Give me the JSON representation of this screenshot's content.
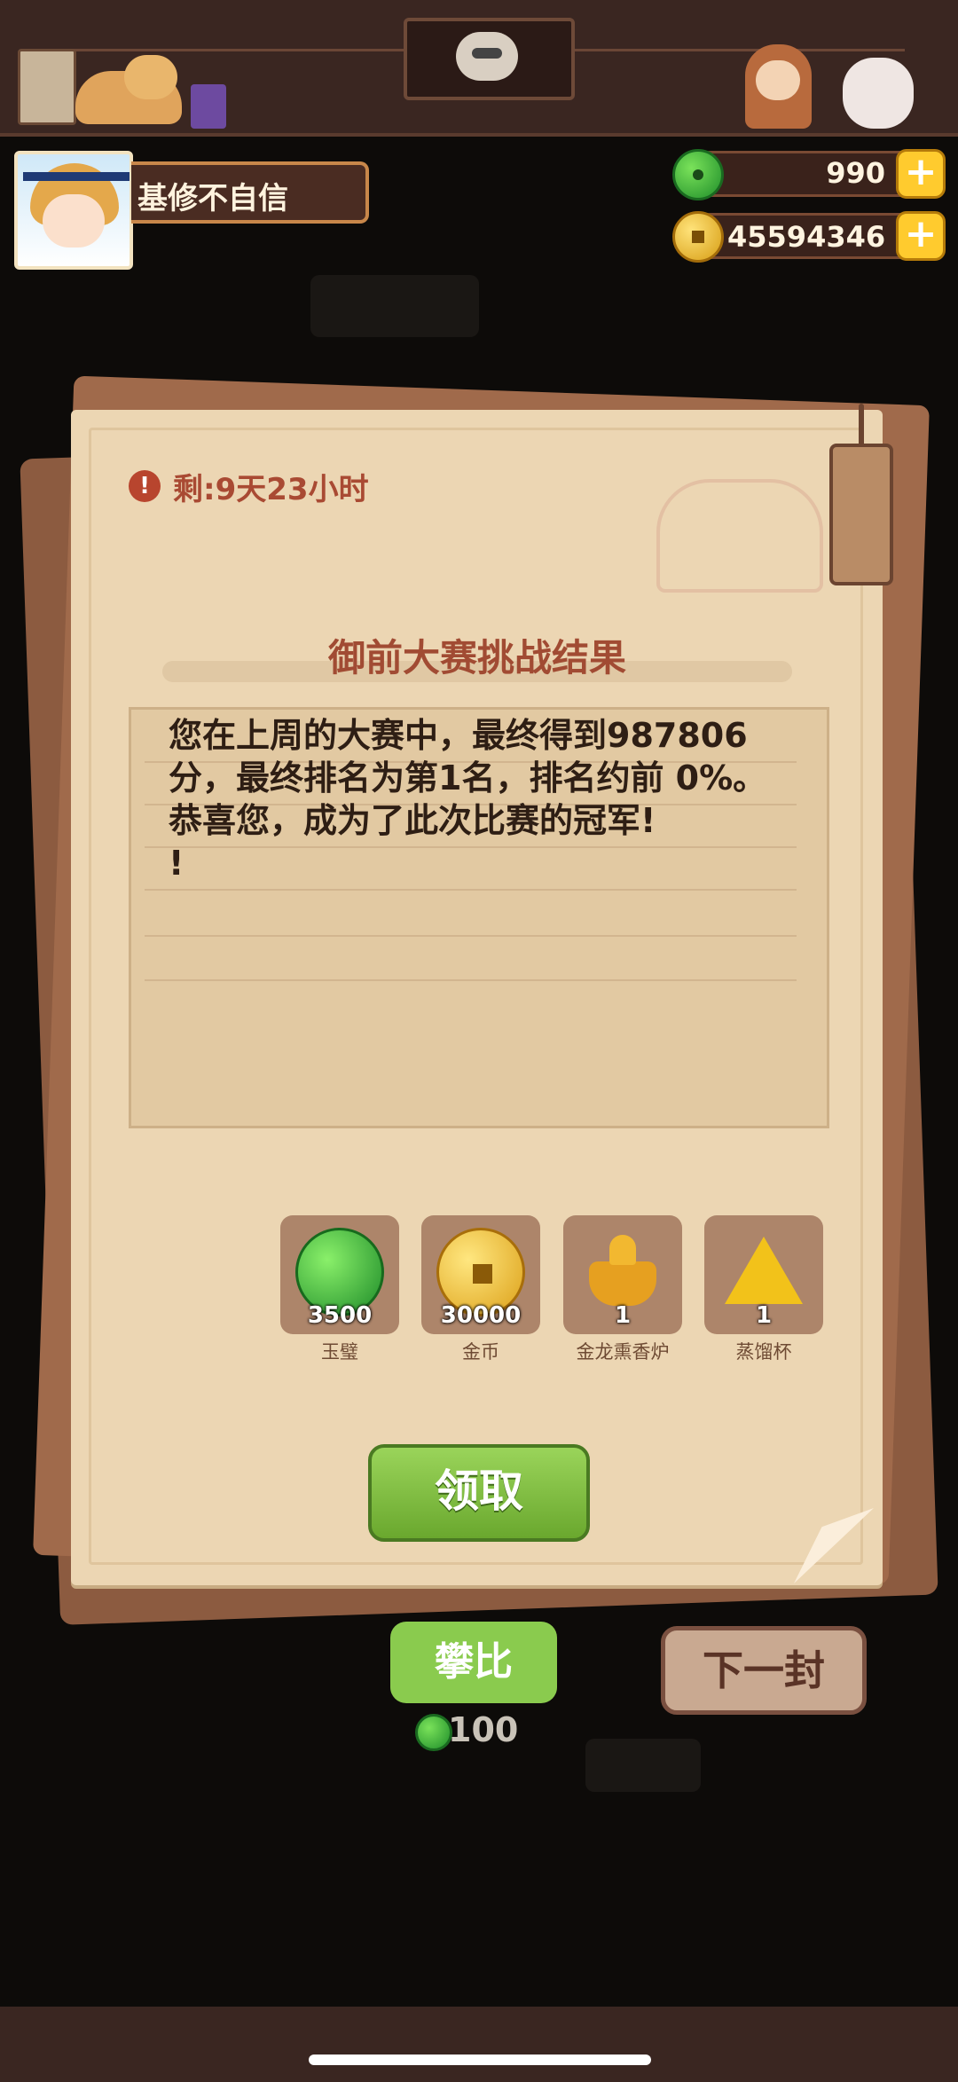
{
  "player": {
    "name": "基修不自信"
  },
  "currency": {
    "jade": {
      "icon": "jade-disc-icon",
      "value": "990"
    },
    "coins": {
      "icon": "gold-coin-icon",
      "value": "45594346"
    }
  },
  "letter": {
    "timer": "剩:9天23小时",
    "title": "御前大赛挑战结果",
    "message": "您在上周的大赛中，最终得到987806分，最终排名为第1名，排名约前 0%。\n恭喜您，成为了此次比赛的冠军!\n!",
    "rewards": [
      {
        "icon": "jade-disc-icon",
        "count": "3500",
        "label": "玉璧"
      },
      {
        "icon": "gold-coin-icon",
        "count": "30000",
        "label": "金币"
      },
      {
        "icon": "golden-censer-icon",
        "count": "1",
        "label": "金龙熏香炉"
      },
      {
        "icon": "distill-cup-icon",
        "count": "1",
        "label": "蒸馏杯"
      }
    ],
    "claim_label": "领取"
  },
  "actions": {
    "compare_label": "攀比",
    "compare_cost": "100",
    "next_label": "下一封"
  },
  "colors": {
    "paper": "#ecd6b3",
    "title": "#a14b33",
    "claim": "#7bbc3e",
    "accent_gold": "#ffcb2e"
  }
}
